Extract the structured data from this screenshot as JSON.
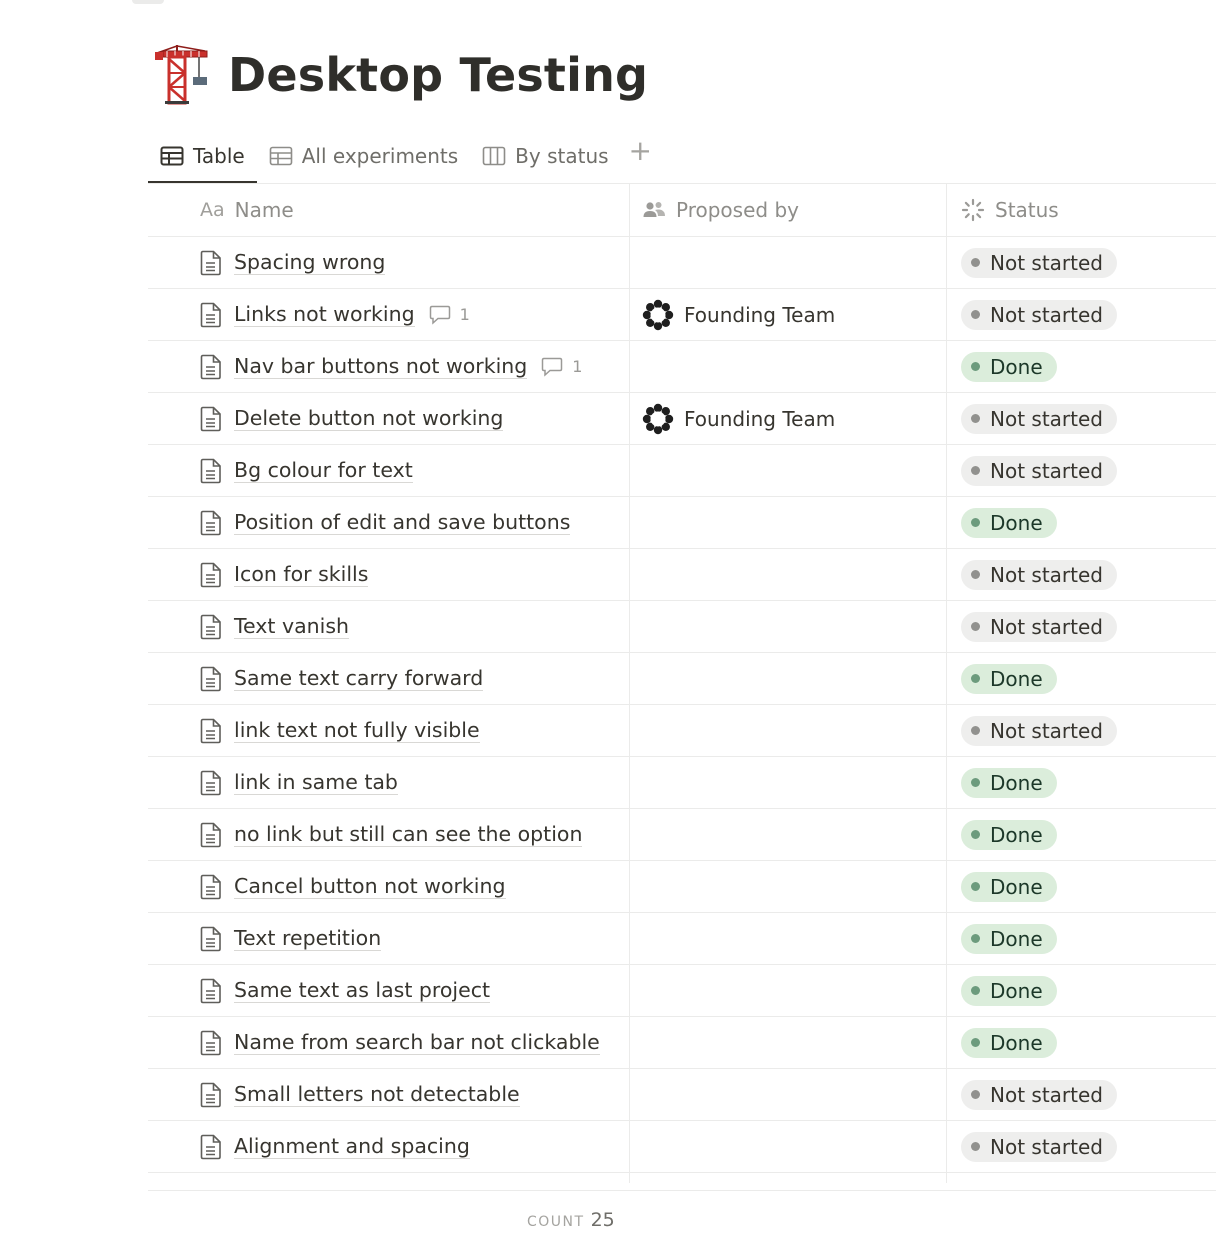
{
  "page": {
    "title": "Desktop Testing",
    "icon": "construction-crane-icon"
  },
  "views": [
    {
      "label": "Table",
      "icon": "table-icon",
      "active": true
    },
    {
      "label": "All experiments",
      "icon": "table-icon",
      "active": false
    },
    {
      "label": "By status",
      "icon": "board-icon",
      "active": false
    }
  ],
  "columns": {
    "name": {
      "label": "Name",
      "icon_text": "Aa"
    },
    "proposed_by": {
      "label": "Proposed by",
      "icon": "people-icon"
    },
    "status": {
      "label": "Status",
      "icon": "status-spinner-icon"
    }
  },
  "rows": [
    {
      "name": "Spacing wrong",
      "comments": "",
      "proposed_by": "",
      "status": "Not started"
    },
    {
      "name": "Links not working",
      "comments": "1",
      "proposed_by": "Founding Team",
      "status": "Not started"
    },
    {
      "name": "Nav bar buttons not working",
      "comments": "1",
      "proposed_by": "",
      "status": "Done"
    },
    {
      "name": "Delete button not working",
      "comments": "",
      "proposed_by": "Founding Team",
      "status": "Not started"
    },
    {
      "name": "Bg colour for text",
      "comments": "",
      "proposed_by": "",
      "status": "Not started"
    },
    {
      "name": "Position of edit and save buttons",
      "comments": "",
      "proposed_by": "",
      "status": "Done"
    },
    {
      "name": "Icon for skills",
      "comments": "",
      "proposed_by": "",
      "status": "Not started"
    },
    {
      "name": "Text vanish",
      "comments": "",
      "proposed_by": "",
      "status": "Not started"
    },
    {
      "name": "Same text carry forward",
      "comments": "",
      "proposed_by": "",
      "status": "Done"
    },
    {
      "name": "link text not fully visible",
      "comments": "",
      "proposed_by": "",
      "status": "Not started"
    },
    {
      "name": "link in same tab",
      "comments": "",
      "proposed_by": "",
      "status": "Done"
    },
    {
      "name": "no link but still can see the option",
      "comments": "",
      "proposed_by": "",
      "status": "Done"
    },
    {
      "name": "Cancel button not working",
      "comments": "",
      "proposed_by": "",
      "status": "Done"
    },
    {
      "name": "Text repetition",
      "comments": "",
      "proposed_by": "",
      "status": "Done"
    },
    {
      "name": "Same text as last project",
      "comments": "",
      "proposed_by": "",
      "status": "Done"
    },
    {
      "name": "Name from search bar not clickable",
      "comments": "",
      "proposed_by": "",
      "status": "Done"
    },
    {
      "name": "Small letters not detectable",
      "comments": "",
      "proposed_by": "",
      "status": "Not started"
    },
    {
      "name": "Alignment and spacing",
      "comments": "",
      "proposed_by": "",
      "status": "Not started"
    }
  ],
  "footer": {
    "count_label": "COUNT",
    "count_value": "25"
  },
  "colors": {
    "text": "#37352f",
    "muted": "#8e8d89",
    "border": "#ebebea",
    "not_started_bg": "#eeeeed",
    "not_started_dot": "#91918e",
    "done_bg": "#dbeddb",
    "done_dot": "#6c9b7d"
  }
}
